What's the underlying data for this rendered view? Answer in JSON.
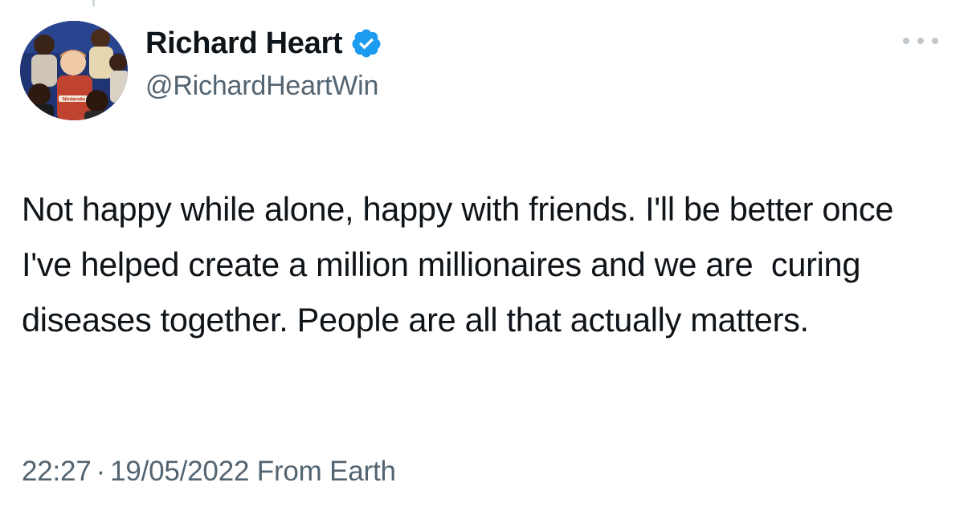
{
  "author": {
    "display_name": "Richard Heart",
    "handle": "@RichardHeartWin",
    "verified": true,
    "avatar_shirt_text": "Nintendo"
  },
  "tweet": {
    "text": "Not happy while alone, happy with friends. I'll be better once I've helped create a million millionaires and we are  curing diseases together. People are all that actually matters."
  },
  "meta": {
    "time": "22:27",
    "separator": "·",
    "date": "19/05/2022",
    "source": "From Earth"
  },
  "icons": {
    "verified": "verified-badge-icon",
    "more": "more-options-icon"
  },
  "colors": {
    "verified_blue": "#1d9bf0",
    "text": "#0f1419",
    "secondary_text": "#536471"
  }
}
